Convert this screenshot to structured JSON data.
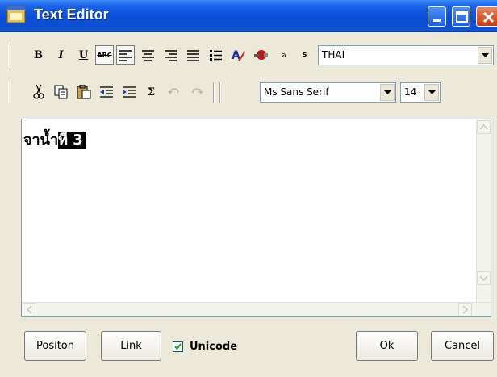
{
  "window": {
    "title": "Text Editor"
  },
  "toolbar1": {
    "bold_label": "B",
    "italic_label": "I",
    "underline_label": "U",
    "strike_label": "ABC",
    "script_label": "s",
    "superscript_label": "ค",
    "charset": "THAI"
  },
  "toolbar2": {
    "sigma_label": "Σ",
    "font_name": "Ms Sans Serif",
    "font_size": "14"
  },
  "editor": {
    "text_plain": "จาน",
    "text_selected": "้ำที่ 3"
  },
  "footer": {
    "position_label": "Positon",
    "link_label": "Link",
    "unicode_label": "Unicode",
    "unicode_checked": true,
    "ok_label": "Ok",
    "cancel_label": "Cancel"
  },
  "colors": {
    "titlebar": "#0a4fd8",
    "selection": "#000000"
  }
}
